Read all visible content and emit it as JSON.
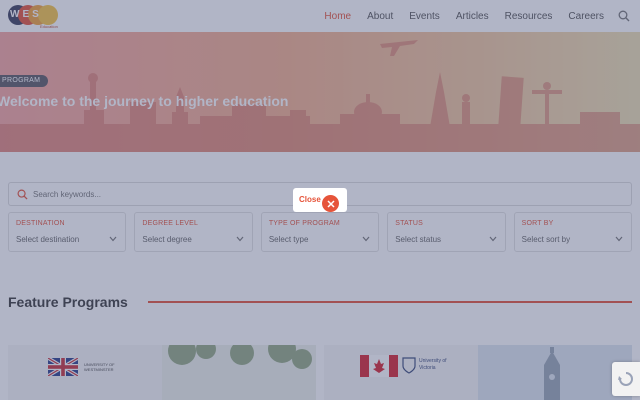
{
  "header": {
    "logo_text": "WES",
    "logo_sub": "Education",
    "nav": [
      "Home",
      "About",
      "Events",
      "Articles",
      "Resources",
      "Careers"
    ],
    "active_index": 0
  },
  "hero": {
    "badge": "PROGRAM",
    "title": "Welcome to the journey to higher education"
  },
  "search": {
    "placeholder": "Search keywords..."
  },
  "filters": [
    {
      "label": "DESTINATION",
      "value": "Select destination"
    },
    {
      "label": "DEGREE LEVEL",
      "value": "Select degree"
    },
    {
      "label": "TYPE OF PROGRAM",
      "value": "Select type"
    },
    {
      "label": "STATUS",
      "value": "Select status"
    },
    {
      "label": "SORT BY",
      "value": "Select sort by"
    }
  ],
  "feature": {
    "title": "Feature Programs"
  },
  "cards": [
    {
      "name": "UNIVERSITY OF WESTMINSTER",
      "kind": "logo-uk"
    },
    {
      "name": "",
      "kind": "photo-trees"
    },
    {
      "name": "University of Victoria",
      "kind": "logo-canada"
    },
    {
      "name": "",
      "kind": "photo-tower"
    }
  ],
  "modal": {
    "close_label": "Close",
    "close_tail": "s"
  },
  "colors": {
    "accent": "#e6543a",
    "overlay": "#464e78",
    "text_dark": "#3a3a3a"
  }
}
